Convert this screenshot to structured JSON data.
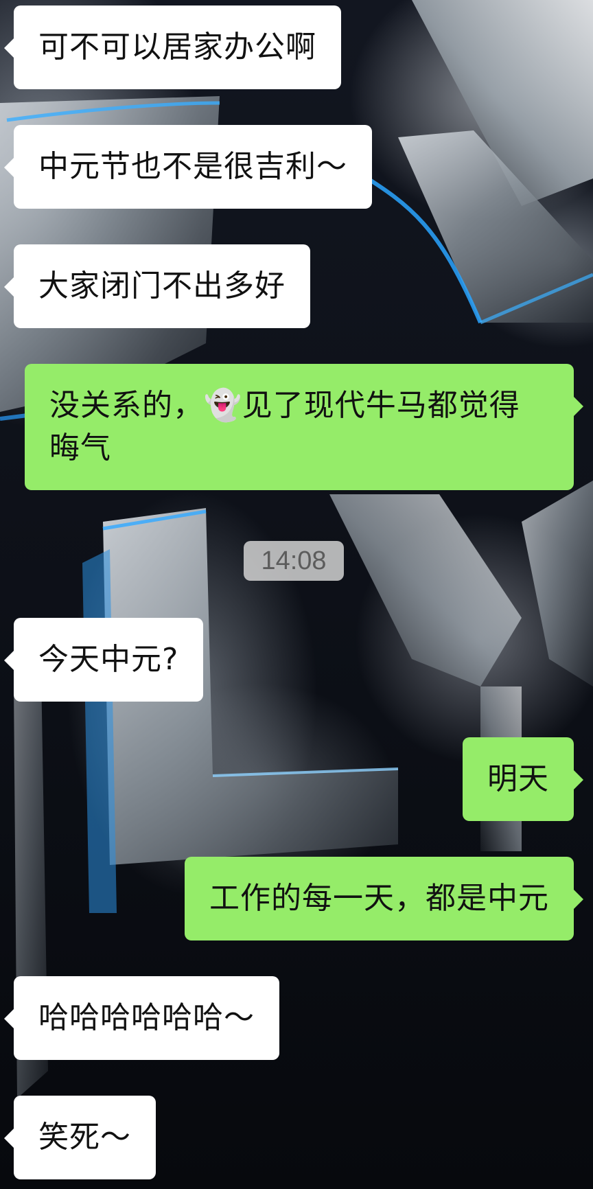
{
  "timestamp": "14:08",
  "messages": [
    {
      "side": "in",
      "text": "可不可以居家办公啊"
    },
    {
      "side": "in",
      "text": "中元节也不是很吉利～"
    },
    {
      "side": "in",
      "text": "大家闭门不出多好"
    },
    {
      "side": "out",
      "text": "没关系的，👻见了现代牛马都觉得晦气"
    },
    {
      "side": "in",
      "text": "今天中元?"
    },
    {
      "side": "out",
      "text": "明天"
    },
    {
      "side": "out",
      "text": "工作的每一天，都是中元"
    },
    {
      "side": "in",
      "text": "哈哈哈哈哈哈～"
    },
    {
      "side": "in",
      "text": "笑死～"
    }
  ],
  "colors": {
    "incoming_bubble": "#ffffff",
    "outgoing_bubble": "#95ec69",
    "timestamp_bg": "#d2d2d2"
  }
}
